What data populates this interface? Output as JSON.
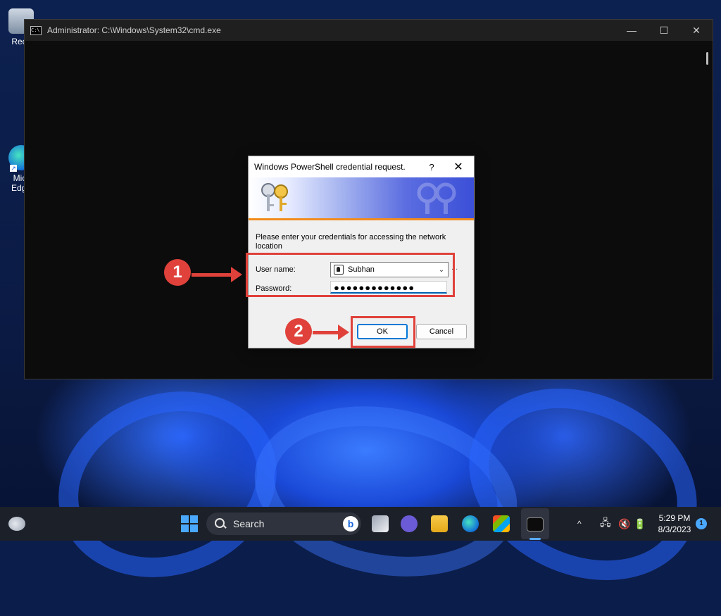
{
  "desktop": {
    "icons": [
      {
        "label": "Recy"
      },
      {
        "label": "Micr Edge"
      }
    ]
  },
  "cmd_window": {
    "title": "Administrator: C:\\Windows\\System32\\cmd.exe",
    "minimize": "—",
    "maximize": "☐",
    "close": "✕"
  },
  "dialog": {
    "title": "Windows PowerShell credential request.",
    "help": "?",
    "close": "✕",
    "message": "Please enter your credentials for accessing the network location",
    "username_label": "User name:",
    "username_value": "Subhan",
    "browse": "...",
    "password_label": "Password:",
    "password_value": "●●●●●●●●●●●●●",
    "ok": "OK",
    "cancel": "Cancel"
  },
  "annotations": {
    "step1": "1",
    "step2": "2",
    "color": "#e0413b"
  },
  "taskbar": {
    "search_placeholder": "Search",
    "bing": "b",
    "chevron": "^",
    "time": "5:29 PM",
    "date": "8/3/2023",
    "notification_count": "1",
    "accent": "#4aa8ff"
  }
}
